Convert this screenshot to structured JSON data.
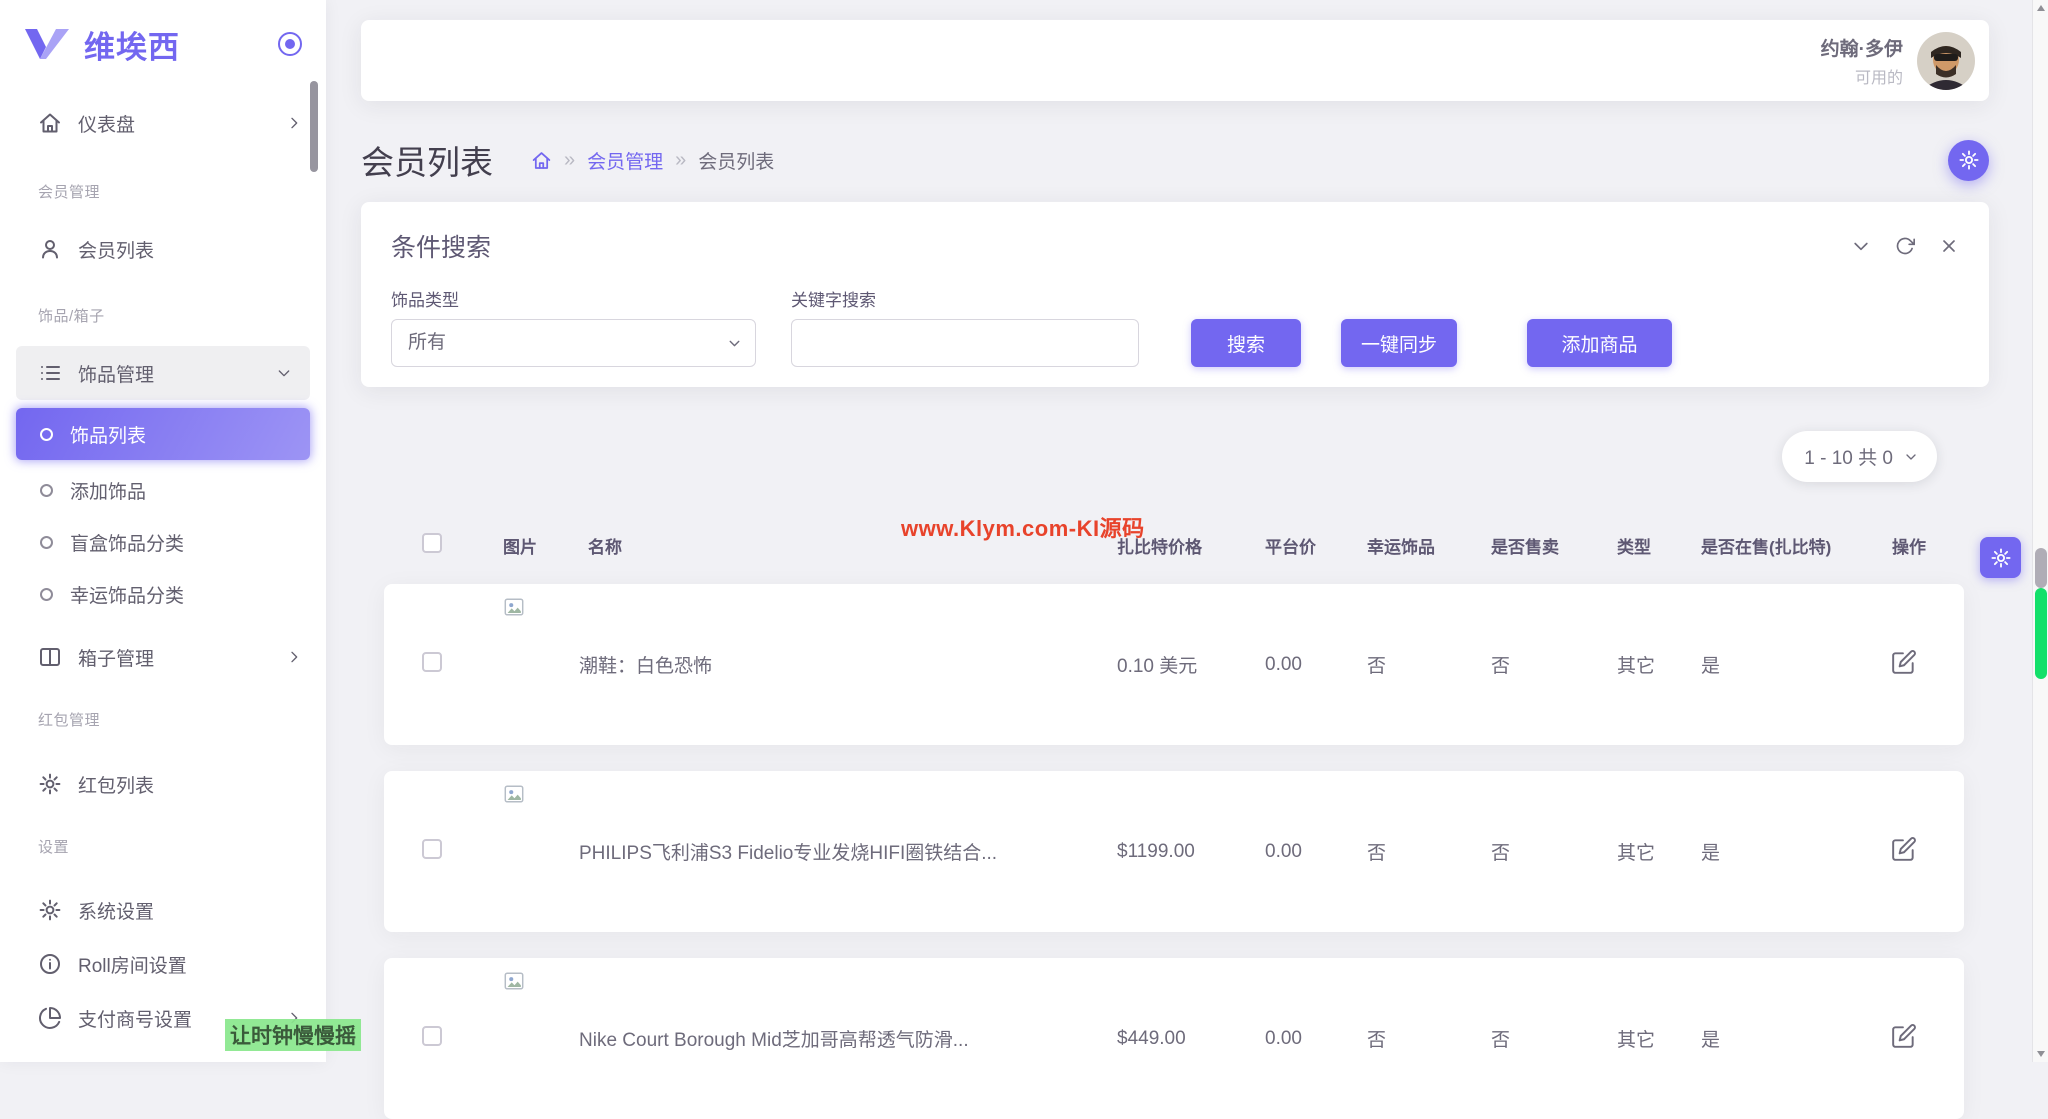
{
  "brand": {
    "name": "维埃西",
    "primary_color": "#7367f0"
  },
  "sidebar": {
    "dashboard": "仪表盘",
    "section_member": "会员管理",
    "member_list": "会员列表",
    "section_accessory": "饰品/箱子",
    "accessory_mgmt": "饰品管理",
    "accessory_list": "饰品列表",
    "add_accessory": "添加饰品",
    "blindbox_category": "盲盒饰品分类",
    "lucky_category": "幸运饰品分类",
    "box_mgmt": "箱子管理",
    "section_redpacket": "红包管理",
    "redpacket_list": "红包列表",
    "section_settings": "设置",
    "system_settings": "系统设置",
    "roll_room": "Roll房间设置",
    "payment_merchant": "支付商号设置",
    "watermark": "让时钟慢慢摇"
  },
  "topbar": {
    "user_name": "约翰·多伊",
    "user_status": "可用的"
  },
  "breadcrumb": {
    "title": "会员列表",
    "separator": "»",
    "parent": "会员管理",
    "current": "会员列表"
  },
  "search": {
    "title": "条件搜索",
    "type_label": "饰品类型",
    "type_value": "所有",
    "keyword_label": "关键字搜索",
    "keyword_value": "",
    "search_btn": "搜索",
    "sync_btn": "一键同步",
    "add_btn": "添加商品"
  },
  "pagination": {
    "label": "1 - 10 共 0"
  },
  "watermark": {
    "center": "www.Klym.com-KI源码"
  },
  "table": {
    "columns": [
      "图片",
      "名称",
      "扎比特价格",
      "平台价",
      "幸运饰品",
      "是否售卖",
      "类型",
      "是否在售(扎比特)",
      "操作"
    ],
    "rows": [
      {
        "name": "潮鞋：白色恐怖",
        "price": "0.10 美元",
        "platform_price": "0.00",
        "lucky": "否",
        "sellable": "否",
        "type": "其它",
        "on_sale": "是"
      },
      {
        "name": "PHILIPS飞利浦S3 Fidelio专业发烧HIFI圈铁结合...",
        "price": "$1199.00",
        "platform_price": "0.00",
        "lucky": "否",
        "sellable": "否",
        "type": "其它",
        "on_sale": "是"
      },
      {
        "name": "Nike Court Borough Mid芝加哥高帮透气防滑...",
        "price": "$449.00",
        "platform_price": "0.00",
        "lucky": "否",
        "sellable": "否",
        "type": "其它",
        "on_sale": "是"
      }
    ]
  }
}
